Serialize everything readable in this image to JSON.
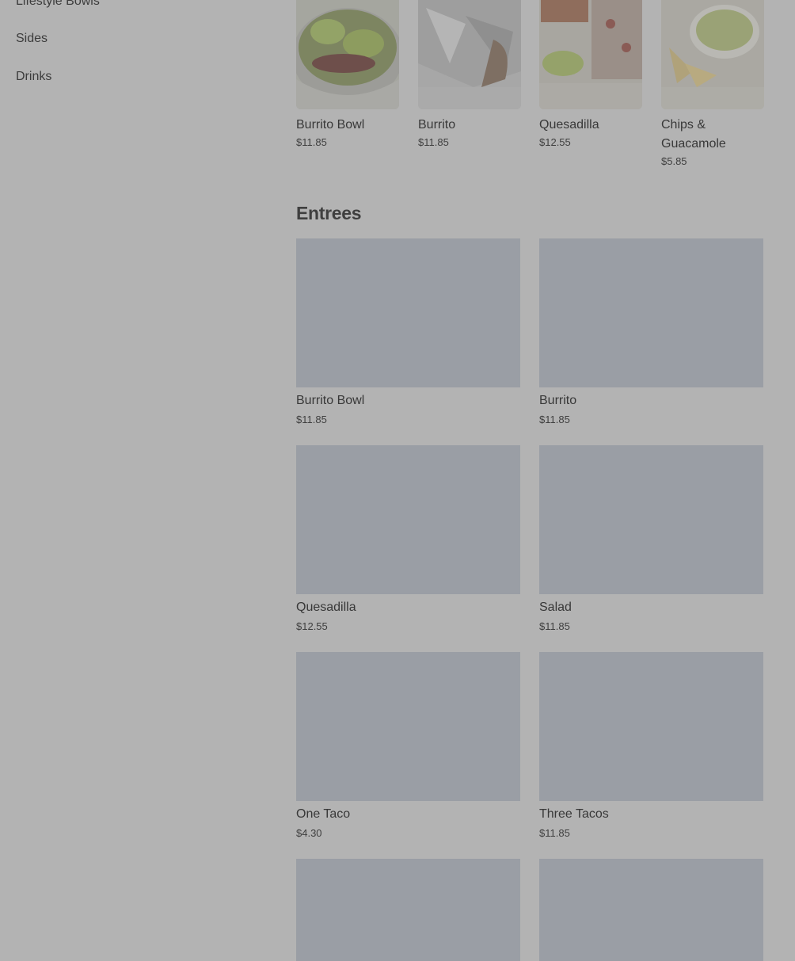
{
  "sidebar": {
    "items": [
      {
        "label": "Lifestyle Bowls"
      },
      {
        "label": "Sides"
      },
      {
        "label": "Drinks"
      }
    ]
  },
  "popular": [
    {
      "name": "Burrito Bowl",
      "price": "$11.85"
    },
    {
      "name": "Burrito",
      "price": "$11.85"
    },
    {
      "name": "Quesadilla",
      "price": "$12.55"
    },
    {
      "name": "Chips & Guacamole",
      "price": "$5.85"
    }
  ],
  "entrees": {
    "title": "Entrees",
    "items": [
      {
        "name": "Burrito Bowl",
        "price": "$11.85"
      },
      {
        "name": "Burrito",
        "price": "$11.85"
      },
      {
        "name": "Quesadilla",
        "price": "$12.55"
      },
      {
        "name": "Salad",
        "price": "$11.85"
      },
      {
        "name": "One Taco",
        "price": "$4.30"
      },
      {
        "name": "Three Tacos",
        "price": "$11.85"
      }
    ]
  },
  "colors": {
    "overlay_background": "#b3b3b3",
    "placeholder_image": "#9a9ea5"
  }
}
